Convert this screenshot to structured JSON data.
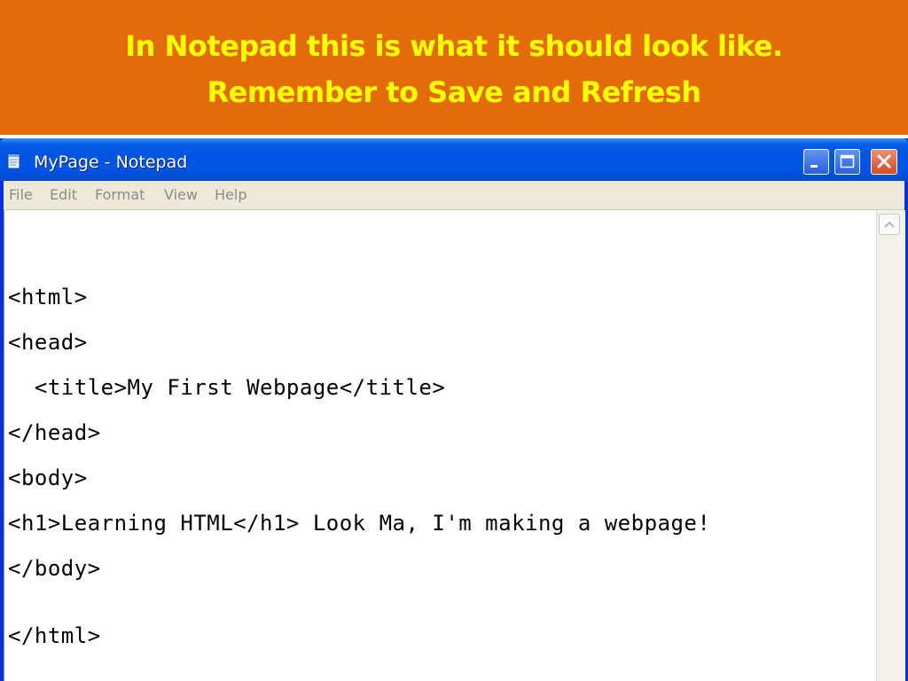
{
  "banner": {
    "line1": "In Notepad this is what it should look like.",
    "line2": "Remember to Save and Refresh"
  },
  "window": {
    "title": "MyPage - Notepad",
    "app_icon": "notepad-icon",
    "controls": {
      "minimize": "minimize-icon",
      "maximize": "maximize-icon",
      "close": "close-icon"
    }
  },
  "menu": [
    "File",
    "Edit",
    "Format",
    "View",
    "Help"
  ],
  "editor": {
    "lines": [
      "<html>",
      "<head>",
      "  <title>My First Webpage</title>",
      "</head>",
      "<body>",
      "<h1>Learning HTML</h1> Look Ma, I'm making a webpage!",
      "</body>",
      "",
      "</html>"
    ]
  },
  "colors": {
    "banner_bg": "#e36c0a",
    "banner_text": "#ffff00",
    "titlebar": "#0054e3",
    "menubar_bg": "#ece9d8"
  }
}
